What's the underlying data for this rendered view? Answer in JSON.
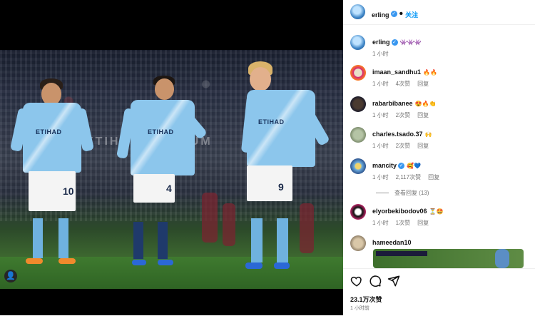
{
  "post": {
    "author": "erling",
    "follow_label": "关注",
    "caption_emojis": "👾👾👾",
    "caption_time": "1 小时",
    "stadium_banner": "ETIHAD STADIUM",
    "players": [
      {
        "number": "10",
        "sponsor": "ETIHAD"
      },
      {
        "number": "4",
        "sponsor": "ETIHAD"
      },
      {
        "number": "9",
        "sponsor": "ETIHAD"
      }
    ]
  },
  "comments": [
    {
      "name": "imaan_sandhu1",
      "emoji": "🔥🔥",
      "time": "1 小时",
      "likes": "4次赞",
      "reply": "回复"
    },
    {
      "name": "rabarbibanee",
      "emoji": "😍🔥👏",
      "time": "1 小时",
      "likes": "2次赞",
      "reply": "回复"
    },
    {
      "name": "charles.tsado.37",
      "emoji": "🙌",
      "time": "1 小时",
      "likes": "2次赞",
      "reply": "回复"
    },
    {
      "name": "mancity",
      "emoji": "🥰💙",
      "time": "1 小时",
      "likes": "2,117次赞",
      "reply": "回复"
    },
    {
      "name": "elyorbekibodov06",
      "emoji": "⏳🤩",
      "time": "1 小时",
      "likes": "1次赞",
      "reply": "回复"
    },
    {
      "name": "hameedan10",
      "emoji": "",
      "time": "",
      "likes": "",
      "reply": ""
    }
  ],
  "view_replies": "查看回复 (13)",
  "actions": {
    "like_icon": "heart-icon",
    "comment_icon": "comment-icon",
    "share_icon": "share-icon"
  },
  "likes_count": "23.1万次赞",
  "posted_ago": "1 小时前",
  "colors": {
    "accent": "#0095f6",
    "verified": "#3897f0",
    "muted": "#737373"
  }
}
